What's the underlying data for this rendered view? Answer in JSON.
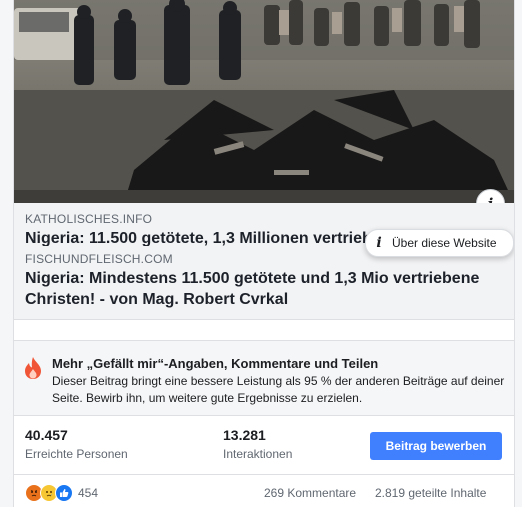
{
  "link_preview_top": {
    "domain": "KATHOLISCHES.INFO",
    "title": "Nigeria: 11.500 getötete, 1,3 Millionen vertriebene"
  },
  "tooltip": {
    "label": "Über diese Website"
  },
  "link_preview_main": {
    "domain": "FISCHUNDFLEISCH.COM",
    "title": "Nigeria: Mindestens 11.500 getötete und 1,3 Mio vertriebene Christen! - von Mag. Robert Cvrkal"
  },
  "boost": {
    "title": "Mehr „Gefällt mir“-Angaben, Kommentare und Teilen",
    "text": "Dieser Beitrag bringt eine bessere Leistung als 95 % der anderen Beiträge auf deiner Seite. Bewirb ihn, um weitere gute Ergebnisse zu erzielen."
  },
  "stats": {
    "reach_value": "40.457",
    "reach_label": "Erreichte Personen",
    "engagement_value": "13.281",
    "engagement_label": "Interaktionen",
    "promote_label": "Beitrag bewerben"
  },
  "footer": {
    "reaction_icons": [
      "angry-reaction-icon",
      "sad-reaction-icon",
      "like-reaction-icon"
    ],
    "reaction_count": "454",
    "comments": "269 Kommentare",
    "shares": "2.819 geteilte Inhalte"
  },
  "colors": {
    "accent": "#4080ff",
    "secondary_text": "#606770",
    "link_bg": "#f2f3f5"
  }
}
